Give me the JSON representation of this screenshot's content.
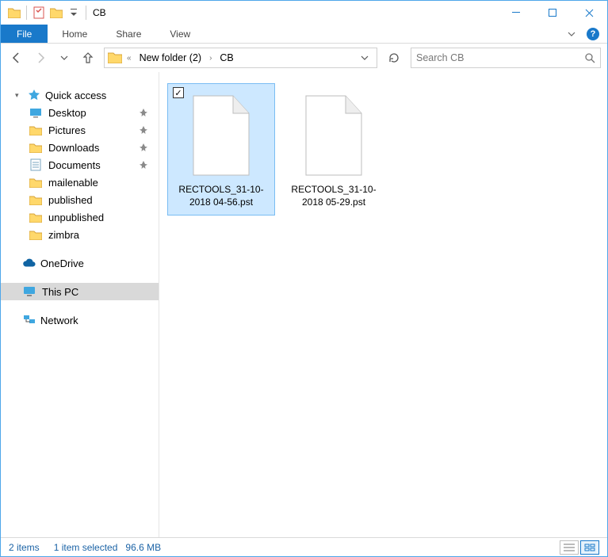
{
  "window": {
    "title": "CB"
  },
  "ribbon": {
    "file": "File",
    "tabs": [
      "Home",
      "Share",
      "View"
    ]
  },
  "address": {
    "crumbs": [
      "New folder (2)",
      "CB"
    ],
    "ellipsis": "«"
  },
  "search": {
    "placeholder": "Search CB"
  },
  "nav": {
    "quick_access": {
      "label": "Quick access",
      "items": [
        {
          "label": "Desktop",
          "pinned": true,
          "icon": "desktop"
        },
        {
          "label": "Pictures",
          "pinned": true,
          "icon": "folder"
        },
        {
          "label": "Downloads",
          "pinned": true,
          "icon": "folder"
        },
        {
          "label": "Documents",
          "pinned": true,
          "icon": "documents"
        },
        {
          "label": "mailenable",
          "pinned": false,
          "icon": "folder"
        },
        {
          "label": "published",
          "pinned": false,
          "icon": "folder"
        },
        {
          "label": "unpublished",
          "pinned": false,
          "icon": "folder"
        },
        {
          "label": "zimbra",
          "pinned": false,
          "icon": "folder"
        }
      ]
    },
    "onedrive": {
      "label": "OneDrive"
    },
    "this_pc": {
      "label": "This PC",
      "selected": true
    },
    "network": {
      "label": "Network"
    }
  },
  "files": [
    {
      "name": "RECTOOLS_31-10-2018 04-56.pst",
      "selected": true
    },
    {
      "name": "RECTOOLS_31-10-2018 05-29.pst",
      "selected": false
    }
  ],
  "status": {
    "count": "2 items",
    "selection": "1 item selected",
    "size": "96.6 MB"
  }
}
